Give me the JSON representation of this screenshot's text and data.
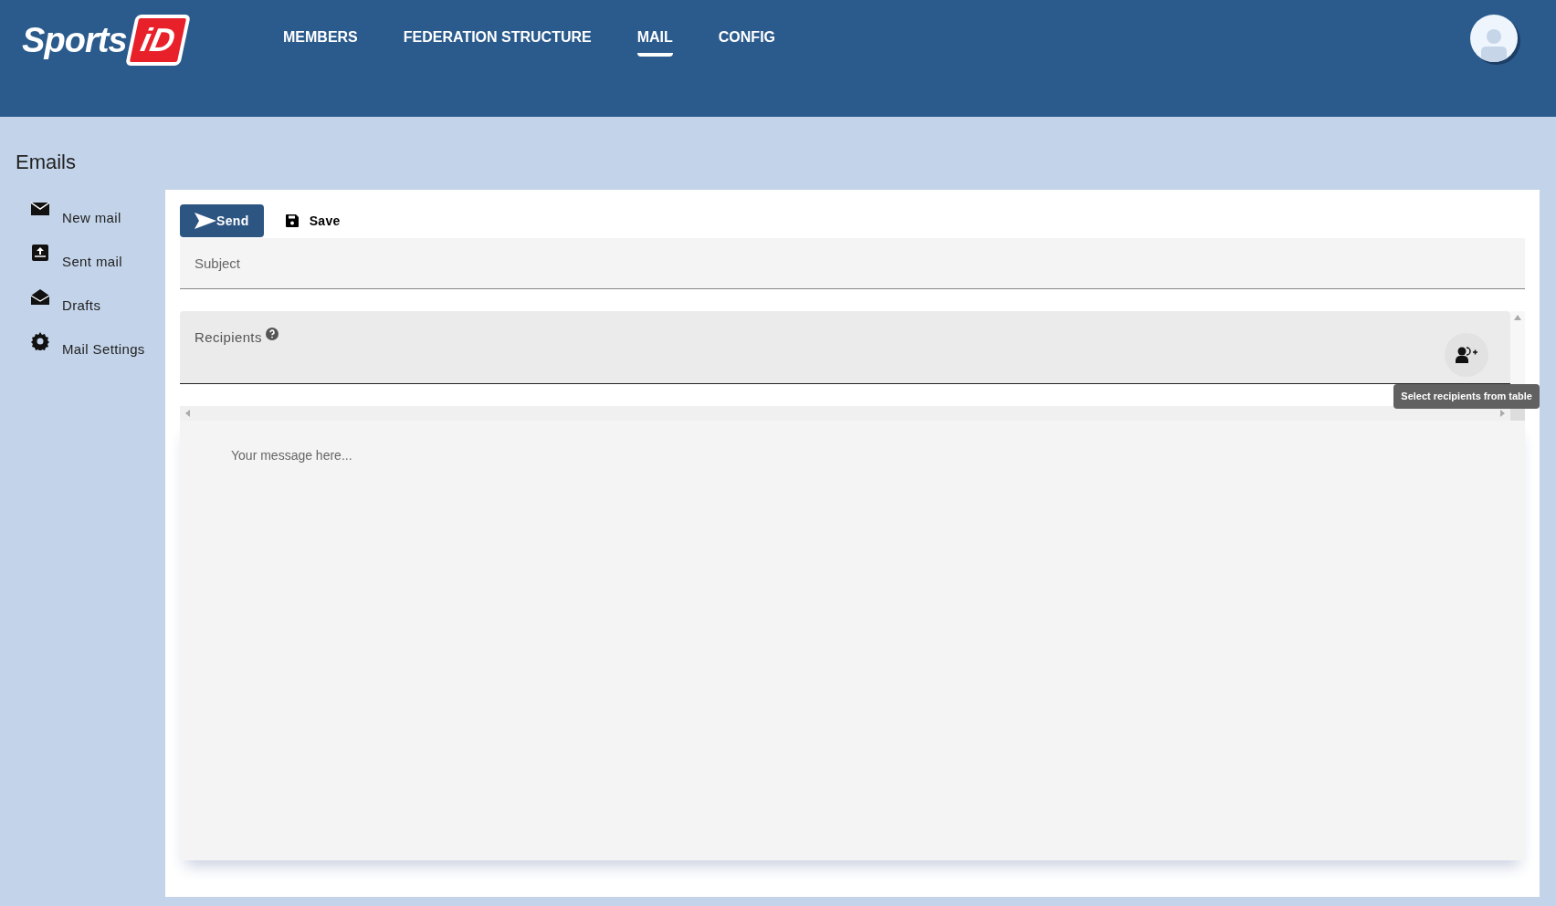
{
  "header": {
    "logo": {
      "word": "Sports",
      "badge": "iD"
    },
    "nav": [
      {
        "label": "MEMBERS",
        "selected": false
      },
      {
        "label": "FEDERATION STRUCTURE",
        "selected": false
      },
      {
        "label": "MAIL",
        "selected": true
      },
      {
        "label": "CONFIG",
        "selected": false
      }
    ]
  },
  "page_title": "Emails",
  "sidebar": {
    "items": [
      {
        "kind": "envelope",
        "label": "New mail"
      },
      {
        "kind": "outbox",
        "label": "Sent mail"
      },
      {
        "kind": "open-envelope",
        "label": "Drafts"
      },
      {
        "kind": "gear",
        "label": "Mail Settings"
      }
    ]
  },
  "toolbar": {
    "send": "Send",
    "save": "Save"
  },
  "form": {
    "subject": {
      "placeholder": "Subject"
    },
    "recipients": {
      "label": "Recipients",
      "tooltip": "Select recipients from table"
    },
    "message": {
      "placeholder": "Your message here..."
    }
  }
}
